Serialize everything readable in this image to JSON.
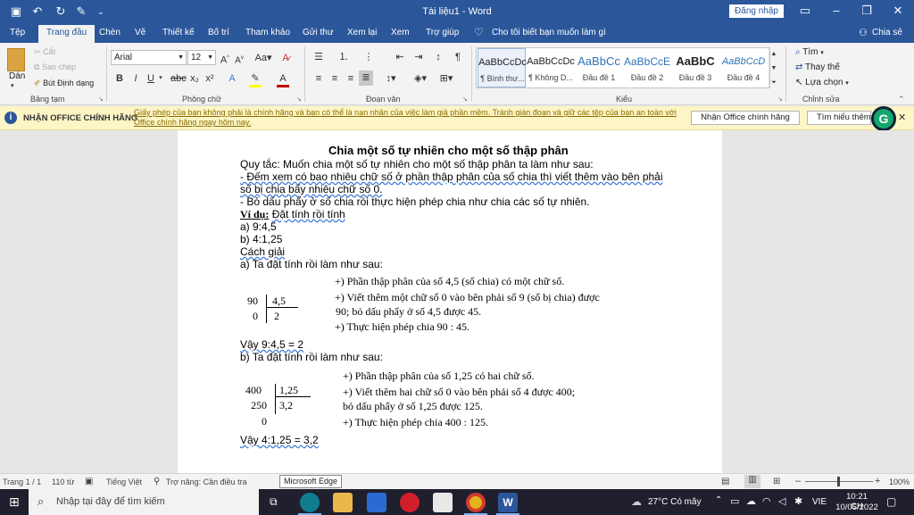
{
  "window": {
    "title": "Tài liệu1 - Word",
    "signin": "Đăng nhập"
  },
  "tabs": [
    "Tệp",
    "Trang đầu",
    "Chèn",
    "Vẽ",
    "Thiết kế",
    "Bố trí",
    "Tham khảo",
    "Gửi thư",
    "Xem lại",
    "Xem",
    "Trợ giúp"
  ],
  "tell_me": "Cho tôi biết bạn muốn làm gì",
  "share": "Chia sẻ",
  "ribbon": {
    "paste": "Dán",
    "cut": "Cắt",
    "copy": "Sao chép",
    "format_painter": "Bút Định dạng",
    "font_name": "Arial",
    "font_size": "12",
    "find": "Tìm",
    "replace": "Thay thế",
    "select": "Lựa chọn",
    "groups": {
      "clipboard": "Bảng tạm",
      "font": "Phông chữ",
      "paragraph": "Đoạn văn",
      "styles": "Kiểu",
      "editing": "Chỉnh sửa"
    },
    "styles": [
      {
        "preview": "AaBbCcDc",
        "name": "¶ Bình thư..."
      },
      {
        "preview": "AaBbCcDc",
        "name": "¶ Không D..."
      },
      {
        "preview": "AaBbCc",
        "name": "Đầu đề 1"
      },
      {
        "preview": "AaBbCcE",
        "name": "Đầu đề 2"
      },
      {
        "preview": "AaBbC",
        "name": "Đầu đề 3"
      },
      {
        "preview": "AaBbCcD",
        "name": "Đầu đề 4"
      }
    ],
    "font_color": "#c00000",
    "highlight_color": "#ffff00"
  },
  "infobar": {
    "label": "NHẬN OFFICE CHÍNH HÃNG",
    "message_line1": "Giấy phép của bạn không phải là chính hãng và bạn có thể là nạn nhân của việc làm giả phần mềm. Tránh gián đoạn và giữ các tệp của bạn an toàn với",
    "message_line2": "Office chính hãng ngay hôm nay.",
    "btn_genuine": "Nhận Office chính hãng",
    "btn_learn": "Tìm hiểu thêm"
  },
  "document": {
    "heading": "Chia một số tự nhiên cho một số thập phân",
    "lines": [
      "Quy tắc: Muốn chia một số tự nhiên cho một số thập phân ta làm như sau:",
      "- Đếm xem có bao nhiêu chữ số ở phần thập phân của số chia thì viết thêm vào bên phải",
      "số bị chia bấy nhiêu chữ số 0.",
      "- Bỏ dấu phẩy ở số chia rồi thực hiện phép chia như chia các số tự nhiên.",
      "Đặt tính rồi tính",
      "a) 9:4,5",
      "b) 4:1,25",
      "Cách giải",
      "a) Ta đặt tính rồi làm như sau:",
      "Vậy 9:4,5 = 2",
      "b) Ta đặt tính rồi làm như sau:",
      "Vậy 4:1,25 = 3,2"
    ],
    "example_label": "Ví dụ:",
    "div_a": {
      "dividend": "90",
      "divisor": "4,5",
      "remainder": "0",
      "quotient": "2"
    },
    "notes_a": [
      "+) Phần thập phân của số 4,5 (số chia) có một chữ số.",
      "+) Viết thêm một chữ số 0 vào bên phải số 9 (số bị chia) được",
      "90; bỏ dấu phẩy ở số 4,5 được 45.",
      "+) Thực hiện phép chia 90 : 45."
    ],
    "div_b": {
      "dividend": "400",
      "divisor": "1,25",
      "step": "250",
      "remainder": "0",
      "quotient": "3,2"
    },
    "notes_b": [
      "+) Phần thập phân của số 1,25 có hai chữ số.",
      "+) Viết thêm hai chữ số 0 vào bên phải số 4 được 400;",
      "bỏ dấu phẩy ở số 1,25 được 125.",
      "+) Thực hiện phép chia 400 : 125."
    ]
  },
  "status": {
    "page": "Trang 1 / 1",
    "words": "110 từ",
    "language": "Tiếng Việt",
    "accessibility": "Trợ năng: Cần điều tra",
    "tooltip": "Microsoft Edge",
    "zoom": "100%"
  },
  "taskbar": {
    "search_placeholder": "Nhập tại đây để tìm kiếm",
    "weather": "27°C Có mây",
    "lang": "VIE",
    "time": "10:21 CH",
    "date": "10/05/2022"
  }
}
